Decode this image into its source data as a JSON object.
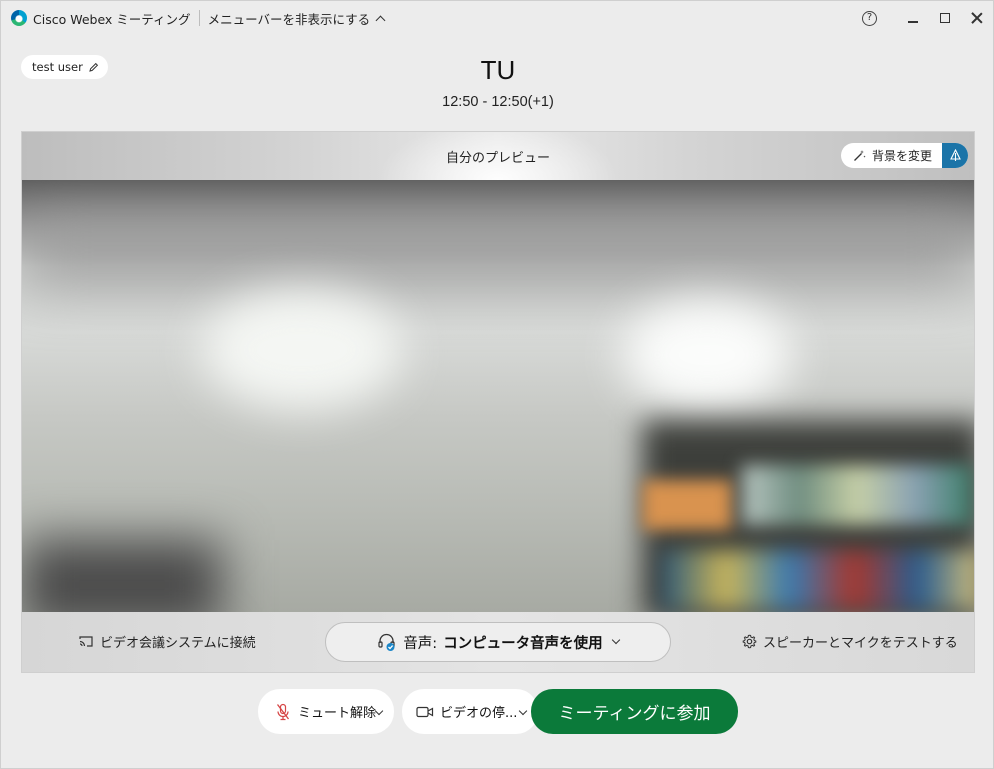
{
  "window": {
    "app_title": "Cisco Webex ミーティング",
    "menu_toggle_label": "メニューバーを非表示にする",
    "help_glyph": "?"
  },
  "user": {
    "name": "test user"
  },
  "meeting": {
    "title": "TU",
    "time": "12:50 - 12:50(+1)"
  },
  "preview": {
    "label": "自分のプレビュー",
    "change_background_label": "背景を変更"
  },
  "footer": {
    "connect_system_label": "ビデオ会議システムに接続",
    "audio_prefix": "音声: ",
    "audio_value": "コンピュータ音声を使用",
    "test_speaker_label": "スピーカーとマイクをテストする"
  },
  "controls": {
    "unmute_label": "ミュート解除",
    "stop_video_label": "ビデオの停...",
    "join_label": "ミーティングに参加"
  },
  "colors": {
    "join_button": "#0b7a3a",
    "background_accent": "#1b74a8",
    "mute_icon": "#d64545"
  }
}
